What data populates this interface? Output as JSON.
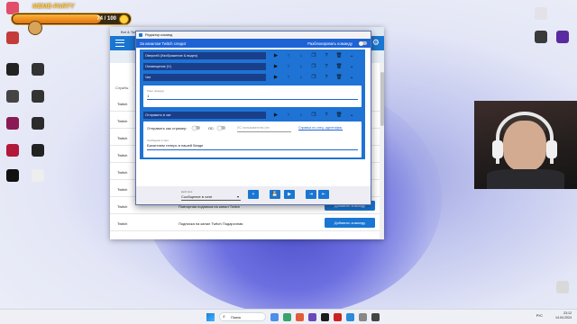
{
  "overlay": {
    "meme_label": "MEME-PARTY",
    "xp_text": "74 / 100",
    "xp_progress": 0.74
  },
  "desktop": {
    "left_icons": [
      {
        "label": "",
        "color": "#e24d6a"
      },
      {
        "label": "",
        "color": "#c43b3b"
      },
      {
        "label": "",
        "color": "#222"
      },
      {
        "label": "",
        "color": "#333"
      },
      {
        "label": "",
        "color": "#444"
      },
      {
        "label": "",
        "color": "#333"
      },
      {
        "label": "",
        "color": "#8a1a55"
      },
      {
        "label": "",
        "color": "#2b2b2b"
      },
      {
        "label": "",
        "color": "#b2183a"
      },
      {
        "label": "",
        "color": "#222"
      },
      {
        "label": "",
        "color": "#111"
      },
      {
        "label": "",
        "color": "#eee"
      }
    ],
    "right_icons": [
      {
        "label": "",
        "color": "#e2e2e8"
      },
      {
        "label": "",
        "color": "#5a2aa0"
      },
      {
        "label": "",
        "color": "#3a3a3a"
      },
      {
        "label": "",
        "color": "#d9d9d9"
      }
    ]
  },
  "main_window": {
    "title": "Bot & Tw...",
    "column_header": "Службы",
    "rows": [
      {
        "service": "Twitch",
        "description": "",
        "add_label": ""
      },
      {
        "service": "Twitch",
        "description": "",
        "add_label": ""
      },
      {
        "service": "Twitch",
        "description": "",
        "add_label": ""
      },
      {
        "service": "Twitch",
        "description": "",
        "add_label": ""
      },
      {
        "service": "Twitch",
        "description": "",
        "add_label": ""
      },
      {
        "service": "Twitch",
        "description": "",
        "add_label": ""
      },
      {
        "service": "Twitch",
        "description": "Повторная подписка на канал Twitch",
        "add_label": "Добавить команду"
      },
      {
        "service": "Twitch",
        "description": "Подписка на канал Twitch Подарочная",
        "add_label": "Добавить команду"
      }
    ]
  },
  "dialog": {
    "title": "Редактор команд",
    "follow_label": "За каналом Twitch следит",
    "unlock_label": "Разблокировать команду",
    "commands": [
      {
        "name": "Оверлей (Изображение & видео)"
      },
      {
        "name": "Оповещение (V)"
      },
      {
        "name": "Чат"
      }
    ],
    "text_field_label": "Тикет (секунд)",
    "text_field_value": "1",
    "fourth_command": "Отправить в чат",
    "send_as_streamer": "Отправить как стример:",
    "lc_label": "ЛС:",
    "user_placeholder": "ЛС пользователю (не",
    "special_id_link": "Справка по спец. идентифик.",
    "message_label": "Сообщение в чате",
    "message_value": "Бахаттаем теперь в нашей банде",
    "action_label": "Действия",
    "action_value": "Сообщение в чате",
    "footer_buttons": [
      "+",
      "💾",
      "▶",
      "⇥",
      "⇤"
    ]
  },
  "taskbar": {
    "search_placeholder": "Поиск",
    "lang": "РУС",
    "time": "23:12",
    "date": "14.04.2024"
  }
}
